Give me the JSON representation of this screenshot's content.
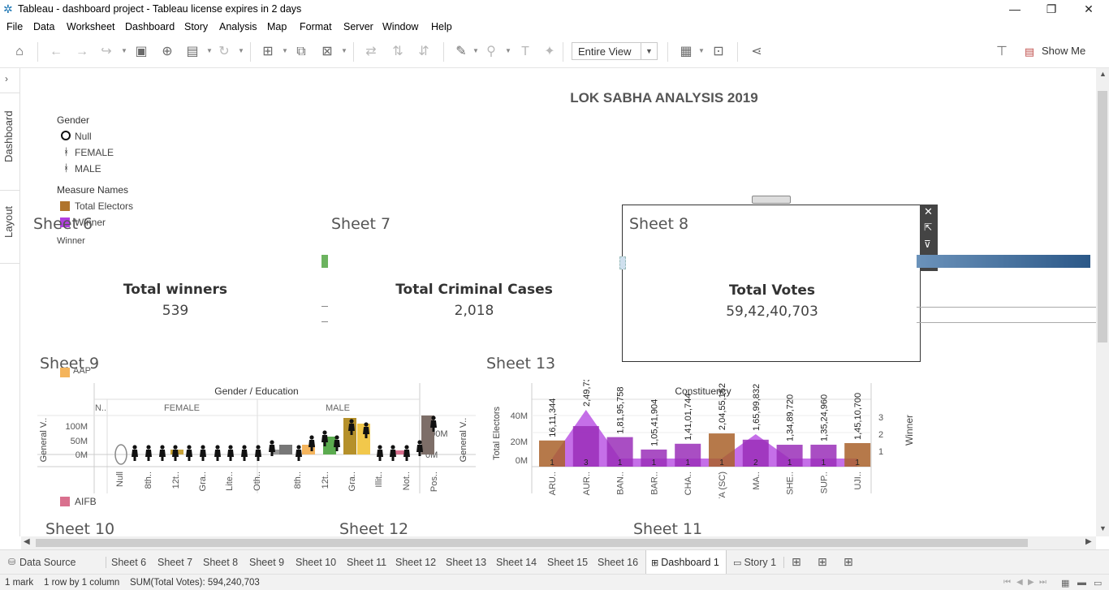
{
  "window": {
    "title": "Tableau - dashboard project - Tableau license expires in 2 days",
    "minimize": "—",
    "restore": "❐",
    "close": "✕"
  },
  "menu": [
    "File",
    "Data",
    "Worksheet",
    "Dashboard",
    "Story",
    "Analysis",
    "Map",
    "Format",
    "Server",
    "Window",
    "Help"
  ],
  "toolbar": {
    "view_select": "Entire View",
    "show_me": "Show Me"
  },
  "side_tabs": {
    "dashboard": "Dashboard",
    "layout": "Layout"
  },
  "dashboard": {
    "title": "LOK SABHA ANALYSIS 2019",
    "legend_gender": {
      "title": "Gender",
      "items": [
        "Null",
        "FEMALE",
        "MALE"
      ]
    },
    "legend_measures": {
      "title": "Measure Names",
      "items": [
        {
          "label": "Total Electors",
          "color": "#b0742c"
        },
        {
          "label": "Winner",
          "color": "#b13fe0"
        }
      ],
      "cut_off": "Winner"
    },
    "party_legend": [
      {
        "label": "AAP",
        "color": "#f4b45c"
      },
      {
        "label": "AIFB",
        "color": "#d9708e"
      }
    ],
    "sheets": {
      "s6": "Sheet 6",
      "s7": "Sheet 7",
      "s8": "Sheet 8",
      "s9": "Sheet 9",
      "s13": "Sheet 13",
      "s10": "Sheet 10",
      "s12": "Sheet 12",
      "s11": "Sheet 11"
    },
    "kpis": [
      {
        "title": "Total winners",
        "value": "539"
      },
      {
        "title": "Total Criminal Cases",
        "value": "2,018"
      },
      {
        "title": "Total Votes",
        "value": "59,42,40,703"
      }
    ],
    "sheet9": {
      "header": "Gender / Education",
      "groups": [
        "N..",
        "FEMALE",
        "MALE"
      ],
      "ylabel_left": "General V..",
      "ylabel_right": "General V..",
      "yticks": [
        "100M",
        "50M",
        "0M"
      ],
      "yticks_right": [
        "100M",
        "0M"
      ],
      "categories": [
        "Null",
        "8th..",
        "12t..",
        "Gra..",
        "Lite..",
        "Oth..",
        "8th..",
        "12t..",
        "Gra..",
        "Illit..",
        "Not..",
        "Pos.."
      ]
    },
    "sheet13": {
      "header": "Constituency",
      "ylabel_left": "Total Electors",
      "ylabel_right": "Winner",
      "yticks": [
        "40M",
        "20M",
        "0M"
      ],
      "yticks_right": [
        "3",
        "2",
        "1"
      ]
    }
  },
  "chart_data": {
    "type": "bar",
    "title": "Constituency",
    "xlabel": "",
    "ylabel": "Total Electors",
    "categories": [
      "ARU..",
      "AUR..",
      "BAN..",
      "BAR..",
      "CHA..",
      "GAYA (SC)",
      "MA..",
      "SHE..",
      "SUP..",
      "UJI.."
    ],
    "series": [
      {
        "name": "Total Electors",
        "values": [
          16111344,
          24973966,
          18195758,
          10541904,
          14101744,
          20455152,
          16599832,
          13489720,
          13524960,
          14510700
        ]
      },
      {
        "name": "Winner",
        "values": [
          1,
          3,
          1,
          1,
          1,
          1,
          2,
          1,
          1,
          1
        ]
      }
    ],
    "data_labels": [
      "16,11,344",
      "2,49,73,966",
      "1,81,95,758",
      "1,05,41,904",
      "1,41,01,744",
      "2,04,55,152",
      "1,65,99,832",
      "1,34,89,720",
      "1,35,24,960",
      "1,45,10,700"
    ],
    "ylim": [
      0,
      45000000
    ]
  },
  "tabs": [
    "Data Source",
    "Sheet 6",
    "Sheet 7",
    "Sheet 8",
    "Sheet 9",
    "Sheet 10",
    "Sheet 11",
    "Sheet 12",
    "Sheet 13",
    "Sheet 14",
    "Sheet 15",
    "Sheet 16",
    "Dashboard 1",
    "Story 1"
  ],
  "status": {
    "marks": "1 mark",
    "rows": "1 row by 1 column",
    "sum": "SUM(Total Votes): 594,240,703"
  }
}
